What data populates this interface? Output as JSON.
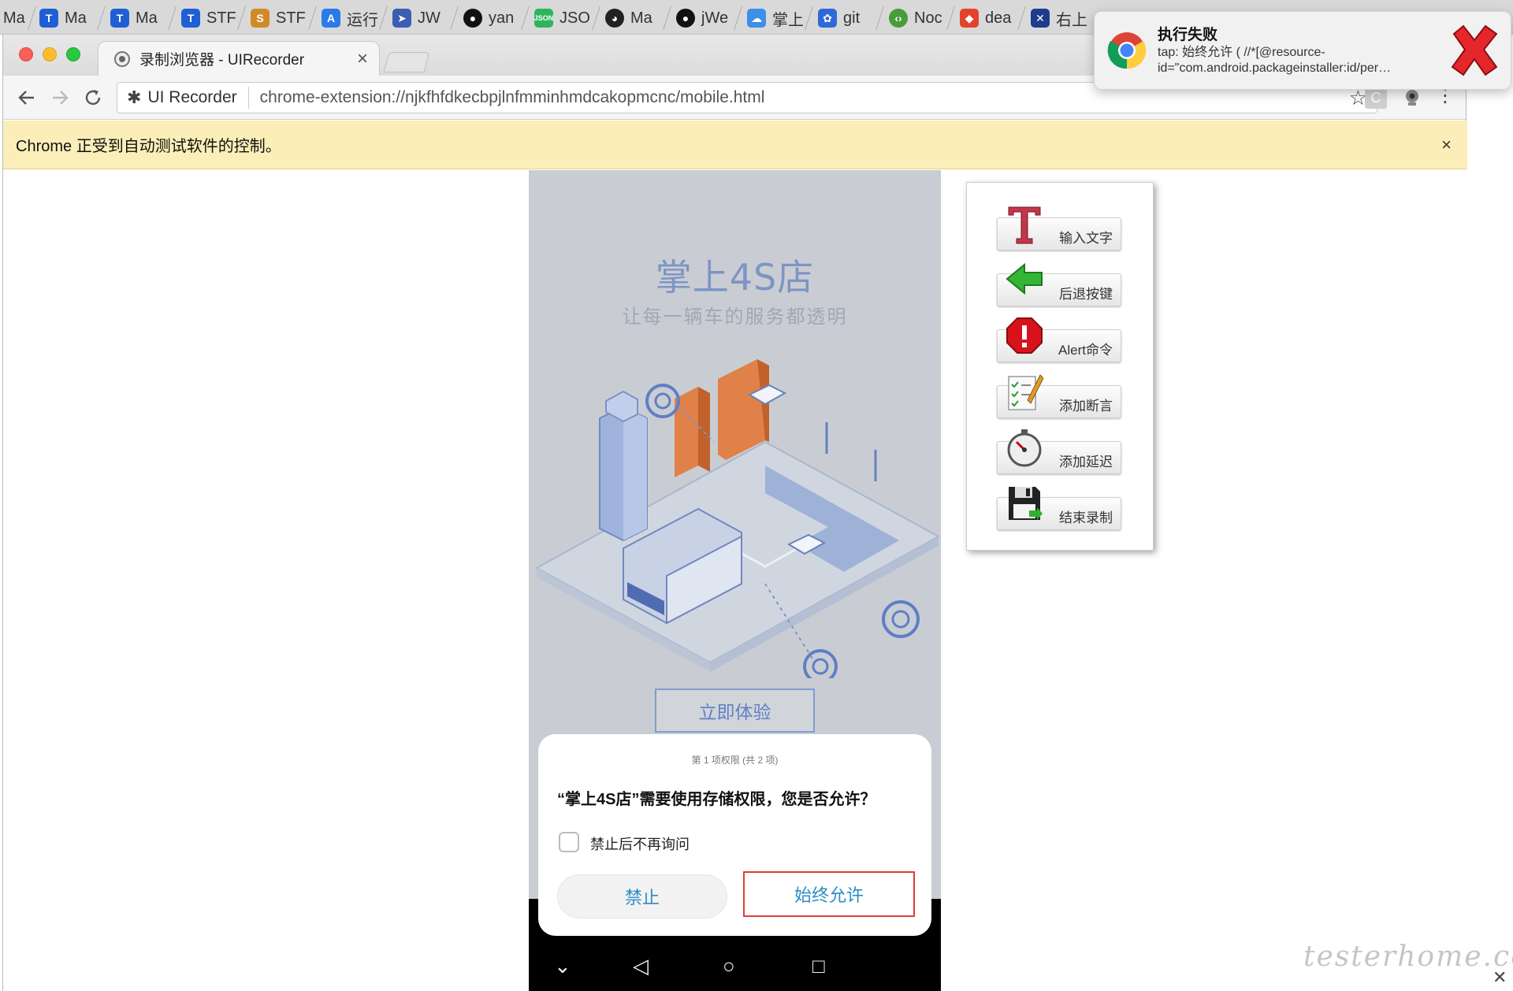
{
  "bookmarks": [
    "Ma",
    "Ma",
    "Ma",
    "STF",
    "STF",
    "运行",
    "JW",
    "yan",
    "JSO",
    "Ma",
    "jWe",
    "掌上",
    "git",
    "Noc",
    "dea",
    "右上"
  ],
  "window": {
    "tab_title": "录制浏览器 - UIRecorder",
    "tab_close": "×",
    "omnibox_ext": "UI Recorder",
    "url": "chrome-extension://njkfhfdkecbpjlnfmminhmdcakopmcnc/mobile.html"
  },
  "infobar": {
    "message": "Chrome 正受到自动测试软件的控制。",
    "close": "×"
  },
  "phone": {
    "app_title": "掌上4S店",
    "app_subtitle": "让每一辆车的服务都透明",
    "try_button": "立即体验",
    "dialog": {
      "step": "第 1 项权限 (共 2 项)",
      "question": "“掌上4S店”需要使用存储权限，您是否允许？",
      "checkbox_label": "禁止后不再询问",
      "deny": "禁止",
      "allow": "始终允许"
    }
  },
  "tools": [
    {
      "label": "输入文字",
      "icon": "text-t-icon"
    },
    {
      "label": "后退按键",
      "icon": "back-arrow-icon"
    },
    {
      "label": "Alert命令",
      "icon": "alert-stop-icon"
    },
    {
      "label": "添加断言",
      "icon": "checklist-pencil-icon"
    },
    {
      "label": "添加延迟",
      "icon": "stopwatch-icon"
    },
    {
      "label": "结束录制",
      "icon": "floppy-disk-icon"
    }
  ],
  "notification": {
    "title": "执行失败",
    "body": "tap: 始终允许 ( //*[@resource-id=\"com.android.packageinstaller:id/per…"
  },
  "watermark": "testerhome.com"
}
